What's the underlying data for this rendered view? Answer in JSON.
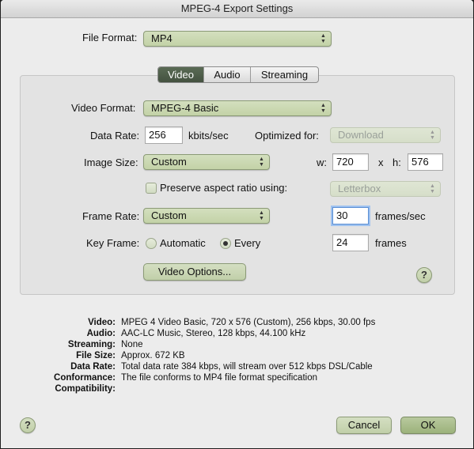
{
  "window": {
    "title": "MPEG-4 Export Settings"
  },
  "file_format": {
    "label": "File Format:",
    "value": "MP4"
  },
  "tabs": [
    {
      "label": "Video",
      "selected": true
    },
    {
      "label": "Audio",
      "selected": false
    },
    {
      "label": "Streaming",
      "selected": false
    }
  ],
  "video": {
    "format_label": "Video Format:",
    "format_value": "MPEG-4 Basic",
    "data_rate_label": "Data Rate:",
    "data_rate_value": "256",
    "data_rate_unit": "kbits/sec",
    "optimized_label": "Optimized for:",
    "optimized_value": "Download",
    "image_size_label": "Image Size:",
    "image_size_value": "Custom",
    "w_label": "w:",
    "w_value": "720",
    "x_label": "x",
    "h_label": "h:",
    "h_value": "576",
    "preserve_label": "Preserve aspect ratio using:",
    "preserve_checked": false,
    "preserve_value": "Letterbox",
    "frame_rate_label": "Frame Rate:",
    "frame_rate_value": "Custom",
    "frame_rate_custom": "30",
    "frame_rate_unit": "frames/sec",
    "key_frame_label": "Key Frame:",
    "key_automatic_label": "Automatic",
    "key_every_label": "Every",
    "key_every_value": "24",
    "key_frames_unit": "frames",
    "options_button": "Video Options...",
    "help": "?"
  },
  "summary": [
    {
      "key": "Video:",
      "value": "MPEG 4 Video Basic, 720 x 576 (Custom), 256 kbps, 30.00 fps"
    },
    {
      "key": "Audio:",
      "value": "AAC-LC Music, Stereo, 128 kbps, 44.100 kHz"
    },
    {
      "key": "Streaming:",
      "value": "None"
    },
    {
      "key": "File Size:",
      "value": "Approx. 672 KB"
    },
    {
      "key": "Data Rate:",
      "value": "Total data rate 384 kbps, will stream over 512 kbps DSL/Cable"
    },
    {
      "key": "Conformance:",
      "value": "The file conforms to MP4 file format specification"
    },
    {
      "key": "Compatibility:",
      "value": ""
    }
  ],
  "footer": {
    "help": "?",
    "cancel": "Cancel",
    "ok": "OK"
  },
  "icons": {
    "popup_arrows": "updown-arrows-icon",
    "help": "help-icon"
  }
}
